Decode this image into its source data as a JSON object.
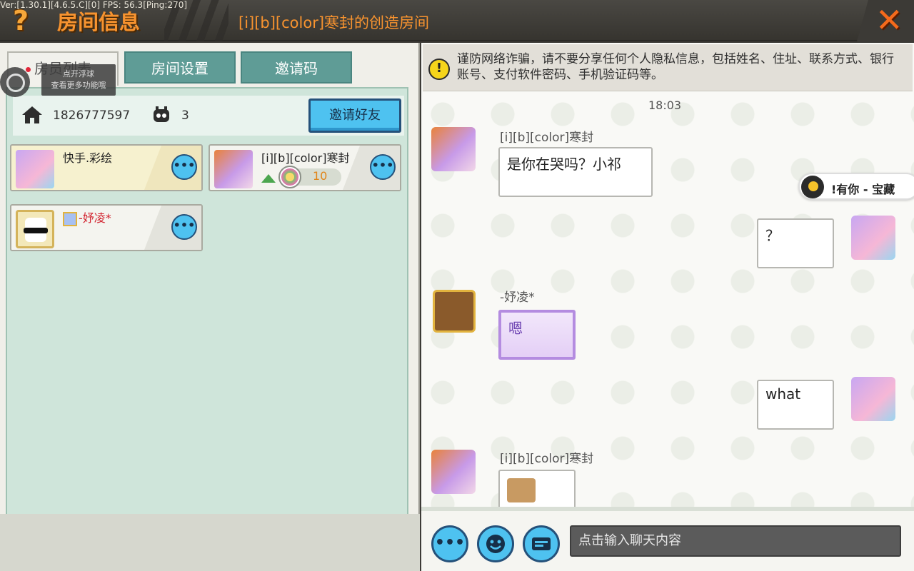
{
  "debug": "Ver:[1.30.1][4.6.5.C][0] FPS: 56.3[Ping:270]",
  "header": {
    "help": "?",
    "title": "房间信息",
    "room_name": "[i][b][color]寒封的创造房间",
    "close": "✕"
  },
  "tabs": [
    {
      "label": "房员列表"
    },
    {
      "label": "房间设置"
    },
    {
      "label": "邀请码"
    }
  ],
  "float_tip": {
    "line1": "点开浮球",
    "line2": "查看更多功能哦"
  },
  "room": {
    "id": "1826777597",
    "count": "3",
    "invite_label": "邀请好友"
  },
  "members": [
    {
      "name": "快手.彩绘"
    },
    {
      "name": "[i][b][color]寒封",
      "level": "10"
    },
    {
      "name": "-妤凌*"
    }
  ],
  "warning": "谨防网络诈骗，请不要分享任何个人隐私信息，包括姓名、住址、联系方式、银行账号、支付软件密码、手机验证码等。",
  "chat": {
    "time": "18:03",
    "messages": [
      {
        "name": "[i][b][color]寒封",
        "text": "是你在哭吗？小祁"
      },
      {
        "text": "？"
      },
      {
        "name": "-妤凌*",
        "text": "嗯"
      },
      {
        "text": "what"
      },
      {
        "name": "[i][b][color]寒封"
      }
    ]
  },
  "toast": "!有你 - 宝藏",
  "input": {
    "placeholder": "点击输入聊天内容"
  },
  "colors": {
    "accent": "#4ec2f0",
    "title": "#f7932f",
    "panel": "#cfe5da"
  }
}
